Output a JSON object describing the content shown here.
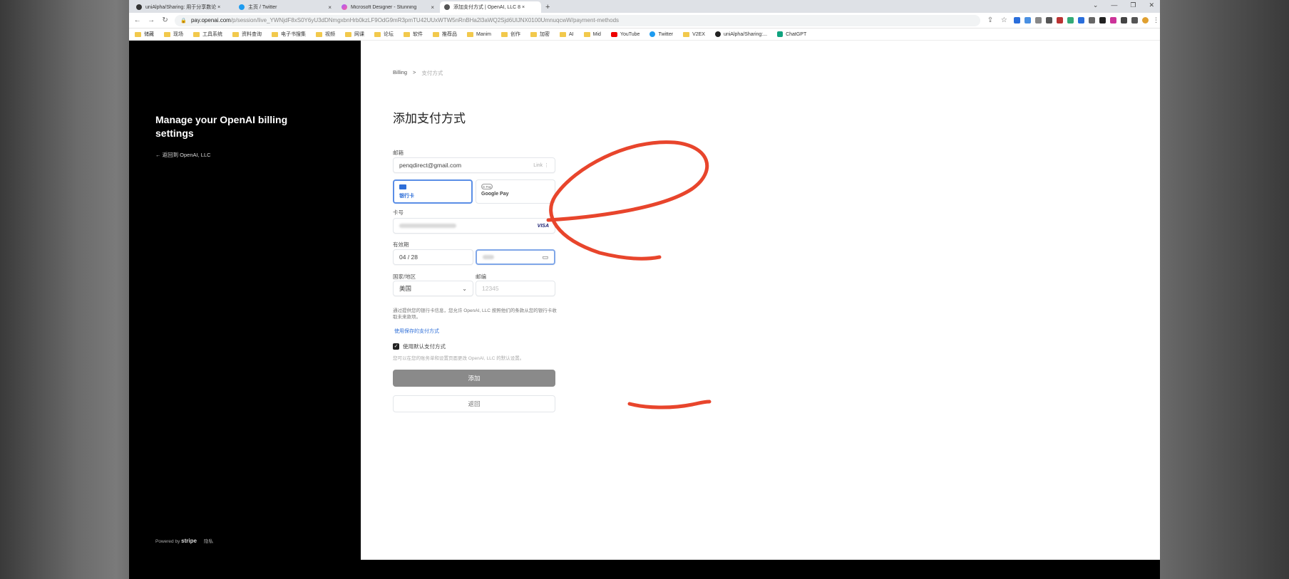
{
  "browser": {
    "tabs": [
      {
        "title": "uniAlpha/Sharing: 用于分享数论 ×",
        "icon": "github-icon"
      },
      {
        "title": "主页 / Twitter",
        "icon": "twitter-icon"
      },
      {
        "title": "Microsoft Designer - Stunning",
        "icon": "designer-icon"
      },
      {
        "title": "添加支付方式 | OpenAI, LLC 8 ×",
        "icon": "openai-icon"
      }
    ],
    "new_tab": "+",
    "url_host": "pay.openai.com",
    "url_path": "/p/session/live_YWNjdF8xS0Y6yU3dDNmgxbnHrb0kzLF9OdG9mR3pmTU42UUxWTW5nRnBHa2l3aWQ2Sjd6UlJNX0100UmnuqcwW/payment-methods",
    "bookmarks": [
      {
        "label": "储藏",
        "type": "folder"
      },
      {
        "label": "现场",
        "type": "folder"
      },
      {
        "label": "工具系统",
        "type": "folder"
      },
      {
        "label": "资料查询",
        "type": "folder"
      },
      {
        "label": "电子书搜集",
        "type": "folder"
      },
      {
        "label": "视频",
        "type": "folder"
      },
      {
        "label": "网课",
        "type": "folder"
      },
      {
        "label": "论坛",
        "type": "folder"
      },
      {
        "label": "软件",
        "type": "folder"
      },
      {
        "label": "推荐品",
        "type": "folder"
      },
      {
        "label": "Manim",
        "type": "folder"
      },
      {
        "label": "创作",
        "type": "folder"
      },
      {
        "label": "加密",
        "type": "folder"
      },
      {
        "label": "AI",
        "type": "folder"
      },
      {
        "label": "Mid",
        "type": "folder"
      },
      {
        "label": "YouTube",
        "type": "youtube"
      },
      {
        "label": "Twitter",
        "type": "twitter"
      },
      {
        "label": "V2EX",
        "type": "folder"
      },
      {
        "label": "uniAlpha/Sharing:...",
        "type": "github"
      },
      {
        "label": "ChatGPT",
        "type": "chatgpt"
      }
    ]
  },
  "left": {
    "title": "Manage your OpenAI billing settings",
    "back_link": "← 返回到 OpenAI, LLC",
    "powered_by": "Powered by",
    "stripe": "stripe",
    "privacy": "隐私"
  },
  "breadcrumb": {
    "root": "Billing",
    "sep": ">",
    "current": "支付方式"
  },
  "heading": "添加支付方式",
  "form": {
    "email_label": "邮箱",
    "email_value": "penqdirect@gmail.com",
    "email_aside": "Link ⋮",
    "method_card": "银行卡",
    "method_gpay": "Google Pay",
    "gpay_badge": "G Pay",
    "card_label": "卡号",
    "card_brand": "VISA",
    "expiry_label": "有效期",
    "expiry_value": "04 / 28",
    "country_label": "国家/地区",
    "country_value": "美国",
    "zip_label": "邮编",
    "zip_placeholder": "12345",
    "authorize_text": "通过提供您的银行卡信息，您允许 OpenAI, LLC 按照他们的条款从您的银行卡收取未来款项。",
    "saved_link": "使用保存的支付方式",
    "default_check": "使用默认支付方式",
    "default_note": "您可以在您的账务单和设置页面更改 OpenAI, LLC 的默认设置。",
    "add_button": "添加",
    "back_button": "返回"
  },
  "colors": {
    "accent": "#2f6fd8",
    "annotation": "#e8452c",
    "primary_button": "#8a8a8a"
  }
}
